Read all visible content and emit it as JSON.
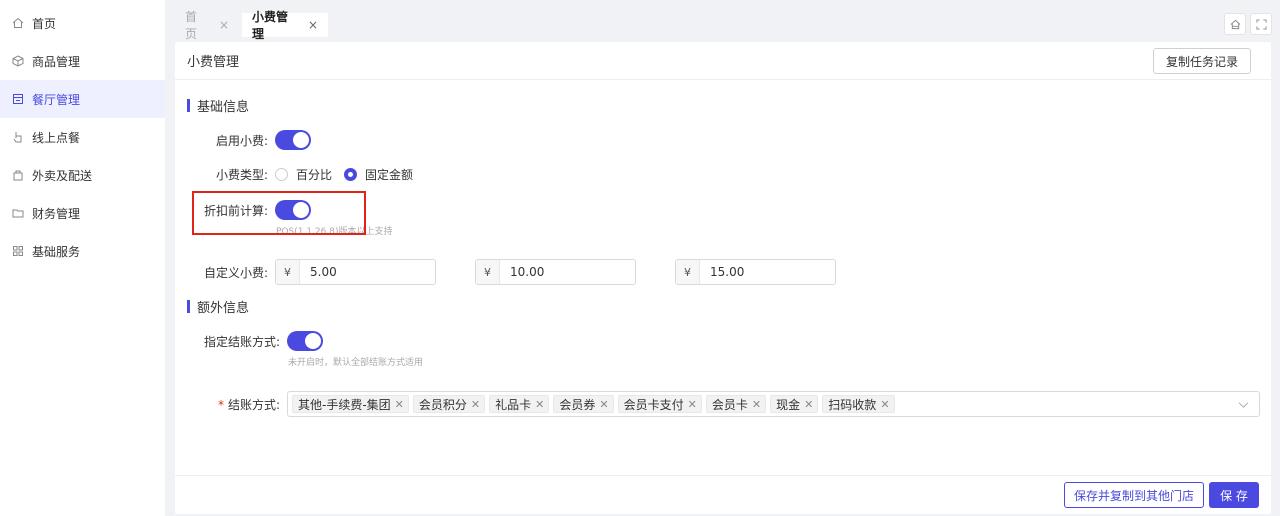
{
  "sidebar": {
    "items": [
      {
        "label": "首页",
        "icon": "home-icon"
      },
      {
        "label": "商品管理",
        "icon": "cube-icon"
      },
      {
        "label": "餐厅管理",
        "icon": "store-icon",
        "active": true
      },
      {
        "label": "线上点餐",
        "icon": "pointer-icon"
      },
      {
        "label": "外卖及配送",
        "icon": "bag-icon"
      },
      {
        "label": "财务管理",
        "icon": "folder-icon"
      },
      {
        "label": "基础服务",
        "icon": "grid-icon"
      }
    ]
  },
  "tabs": [
    {
      "label": "首页",
      "close": "×"
    },
    {
      "label": "小费管理",
      "close": "×"
    }
  ],
  "page": {
    "title": "小费管理",
    "copy_log_button": "复制任务记录"
  },
  "basic": {
    "section_title": "基础信息",
    "enable_tip_label": "启用小费:",
    "enable_tip_on": true,
    "tip_type_label": "小费类型:",
    "tip_type_options": [
      "百分比",
      "固定金额"
    ],
    "tip_type_selected": "固定金额",
    "pre_discount_label": "折扣前计算:",
    "pre_discount_on": true,
    "pre_discount_hint": "POS(1.1.26.8)版本以上支持",
    "custom_tip_label": "自定义小费:",
    "currency_symbol": "¥",
    "custom_tips": [
      "5.00",
      "10.00",
      "15.00"
    ]
  },
  "extra": {
    "section_title": "额外信息",
    "payment_method_toggle_label": "指定结账方式:",
    "payment_method_toggle_on": true,
    "payment_method_hint": "未开启时，默认全部结账方式适用",
    "payment_methods_label": "结账方式:",
    "required_mark": "*",
    "payment_methods": [
      "其他-手续费-集团",
      "会员积分",
      "礼品卡",
      "会员券",
      "会员卡支付",
      "会员卡",
      "现金",
      "扫码收款"
    ]
  },
  "footer": {
    "save_copy_button": "保存并复制到其他门店",
    "save_button": "保 存"
  },
  "colors": {
    "accent": "#4a4ae0",
    "highlight_border": "#e2231a"
  }
}
